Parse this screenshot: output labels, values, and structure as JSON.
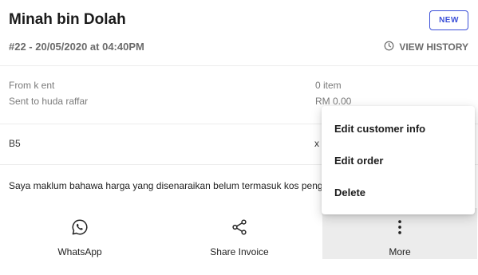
{
  "header": {
    "customer_name": "Minah bin Dolah",
    "badge": "NEW",
    "order_ref": "#22 - 20/05/2020 at 04:40PM",
    "view_history": "VIEW HISTORY"
  },
  "details": {
    "from": "From k ent",
    "sent_to": "Sent to huda raffar",
    "item_count": "0 item",
    "total": "RM 0.00",
    "code": "B5",
    "qty": "x",
    "disclaimer": "Saya maklum bahawa harga yang disenaraikan belum termasuk kos pengepakan"
  },
  "actions": [
    {
      "label": "WhatsApp",
      "icon": "whatsapp-icon"
    },
    {
      "label": "Share Invoice",
      "icon": "share-icon"
    },
    {
      "label": "More",
      "icon": "more-vertical-icon"
    }
  ],
  "menu": {
    "items": [
      {
        "label": "Edit customer info"
      },
      {
        "label": "Edit order"
      },
      {
        "label": "Delete"
      }
    ]
  },
  "colors": {
    "accent": "#3b4fd8",
    "muted_text": "#7a7a7a",
    "selected_bg": "#ececec"
  }
}
